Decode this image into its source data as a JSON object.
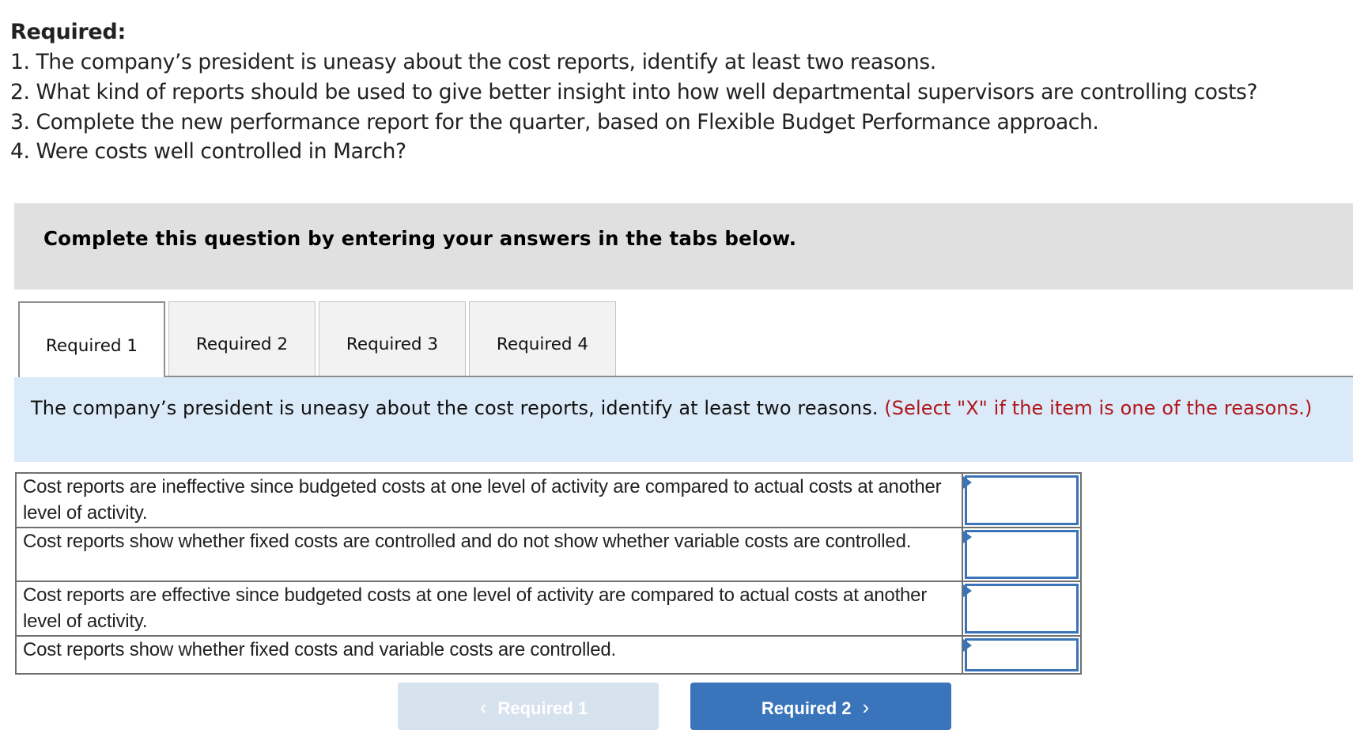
{
  "required": {
    "title": "Required:",
    "items": [
      "1. The company’s president is uneasy about the cost reports, identify at least two reasons.",
      "2. What kind of reports should be used to give better insight into how well departmental supervisors are controlling costs?",
      "3. Complete the new performance report for the quarter, based on Flexible Budget Performance approach.",
      "4. Were costs well controlled in March?"
    ]
  },
  "banner": {
    "text": "Complete this question by entering your answers in the tabs below."
  },
  "tabs": [
    {
      "label": "Required 1",
      "active": true
    },
    {
      "label": "Required 2",
      "active": false
    },
    {
      "label": "Required 3",
      "active": false
    },
    {
      "label": "Required 4",
      "active": false
    }
  ],
  "prompt": {
    "question": "The company’s president is uneasy about the cost reports, identify at least two reasons.",
    "instruction": "(Select \"X\" if the item is one of the reasons.)"
  },
  "answer_table": {
    "rows": [
      {
        "description": "Cost reports are ineffective since budgeted costs at one level of activity are compared to actual costs at another level of activity.",
        "value": ""
      },
      {
        "description": "Cost reports show whether fixed costs are controlled and do not show whether variable costs are controlled.",
        "value": ""
      },
      {
        "description": "Cost reports are effective since budgeted costs at one level of activity are compared to actual costs at another level of activity.",
        "value": ""
      },
      {
        "description": "Cost reports show whether fixed costs and variable costs are controlled.",
        "value": ""
      }
    ]
  },
  "navigation": {
    "prev_label": "Required 1",
    "next_label": "Required 2",
    "prev_icon": "chevron-left-icon",
    "next_icon": "chevron-right-icon",
    "prev_chevron": "‹",
    "next_chevron": "›"
  },
  "colors": {
    "accent": "#3a75bb",
    "instruction_text": "#b0161b",
    "info_bg": "#dbeaf8",
    "banner_bg": "#e0e0e0"
  }
}
